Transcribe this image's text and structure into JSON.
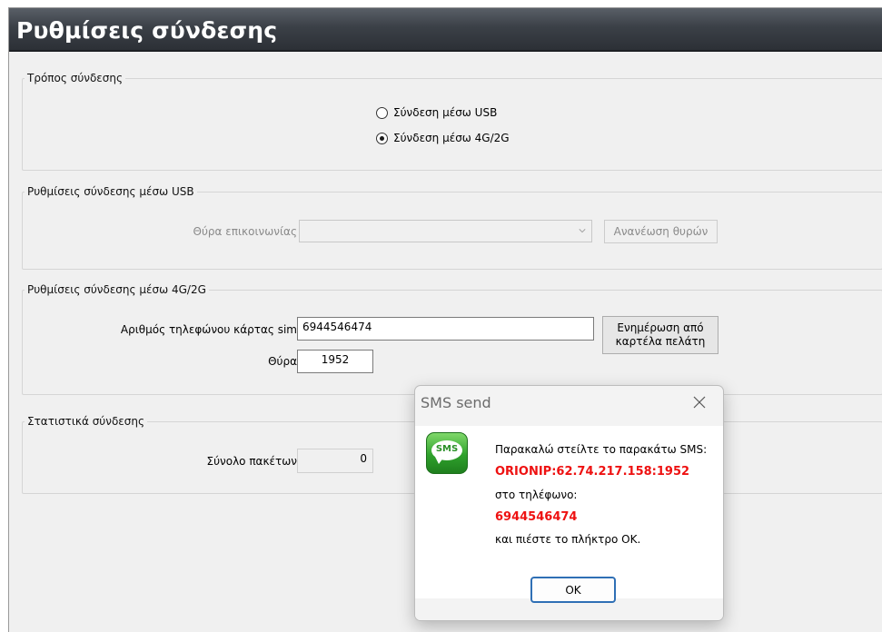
{
  "window": {
    "title": "Ρυθμίσεις σύνδεσης"
  },
  "connection_mode": {
    "label": "Τρόπος σύνδεσης",
    "options": [
      {
        "label": "Σύνδεση μέσω USB",
        "selected": false
      },
      {
        "label": "Σύνδεση μέσω 4G/2G",
        "selected": true
      }
    ]
  },
  "usb_settings": {
    "label": "Ρυθμίσεις σύνδεσης μέσω USB",
    "port_label": "Θύρα επικοινωνίας",
    "port_value": "",
    "refresh_button": "Ανανέωση θυρών"
  },
  "g4_settings": {
    "label": "Ρυθμίσεις σύνδεσης μέσω 4G/2G",
    "phone_label": "Αριθμός τηλεφώνου κάρτας sim",
    "phone_value": "6944546474",
    "update_button_line1": "Ενημέρωση από",
    "update_button_line2": "καρτέλα πελάτη",
    "port_label": "Θύρα",
    "port_value": "1952"
  },
  "stats": {
    "label": "Στατιστικά σύνδεσης",
    "packets_label": "Σύνολο πακέτων",
    "packets_value": "0"
  },
  "dialog": {
    "title": "SMS send",
    "icon_text": "SMS",
    "line1": "Παρακαλώ στείλτε το παρακάτω SMS:",
    "sms_content": "ORIONIP:62.74.217.158:1952",
    "line3": "στο τηλέφωνο:",
    "phone": "6944546474",
    "line5": "και πιέστε το πλήκτρο ΟΚ.",
    "ok_button": "OK"
  },
  "colors": {
    "titlebar": "#3b4047",
    "highlight_red": "#ee1111",
    "ok_border": "#2f6fb5",
    "sms_icon_green": "#2fa12c"
  }
}
